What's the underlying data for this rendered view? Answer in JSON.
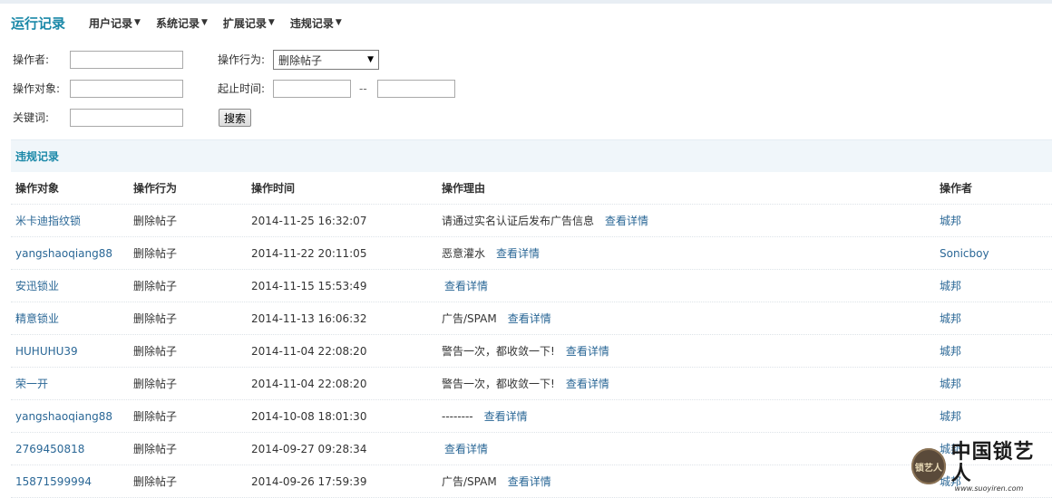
{
  "nav": {
    "title": "运行记录",
    "items": [
      {
        "label": "用户记录"
      },
      {
        "label": "系统记录"
      },
      {
        "label": "扩展记录"
      },
      {
        "label": "违规记录"
      }
    ]
  },
  "search": {
    "operator_label": "操作者:",
    "operator_value": "",
    "target_label": "操作对象:",
    "target_value": "",
    "keyword_label": "关键词:",
    "keyword_value": "",
    "action_label": "操作行为:",
    "action_selected": "删除帖子",
    "time_label": "起止时间:",
    "time_start": "",
    "time_end": "",
    "time_separator": "--",
    "search_button": "搜索"
  },
  "section": {
    "title": "违规记录"
  },
  "table": {
    "columns": [
      "操作对象",
      "操作行为",
      "操作时间",
      "操作理由",
      "操作者"
    ],
    "rows": [
      {
        "target": "米卡迪指纹锁",
        "action": "删除帖子",
        "time": "2014-11-25 16:32:07",
        "reason": "请通过实名认证后发布广告信息",
        "detail": "查看详情",
        "operator": "城邦"
      },
      {
        "target": "yangshaoqiang88",
        "action": "删除帖子",
        "time": "2014-11-22 20:11:05",
        "reason": "恶意灌水",
        "detail": "查看详情",
        "operator": "Sonicboy"
      },
      {
        "target": "安迅锁业",
        "action": "删除帖子",
        "time": "2014-11-15 15:53:49",
        "reason": "",
        "detail": "查看详情",
        "operator": "城邦"
      },
      {
        "target": "精意锁业",
        "action": "删除帖子",
        "time": "2014-11-13 16:06:32",
        "reason": "广告/SPAM",
        "detail": "查看详情",
        "operator": "城邦"
      },
      {
        "target": "HUHUHU39",
        "action": "删除帖子",
        "time": "2014-11-04 22:08:20",
        "reason": "警告一次，都收敛一下!",
        "detail": "查看详情",
        "operator": "城邦"
      },
      {
        "target": "荣一开",
        "action": "删除帖子",
        "time": "2014-11-04 22:08:20",
        "reason": "警告一次，都收敛一下!",
        "detail": "查看详情",
        "operator": "城邦"
      },
      {
        "target": "yangshaoqiang88",
        "action": "删除帖子",
        "time": "2014-10-08 18:01:30",
        "reason": "--------",
        "detail": "查看详情",
        "operator": "城邦"
      },
      {
        "target": "2769450818",
        "action": "删除帖子",
        "time": "2014-09-27 09:28:34",
        "reason": "",
        "detail": "查看详情",
        "operator": "城邦"
      },
      {
        "target": "15871599994",
        "action": "删除帖子",
        "time": "2014-09-26 17:59:39",
        "reason": "广告/SPAM",
        "detail": "查看详情",
        "operator": "城邦"
      }
    ]
  },
  "watermark": {
    "seal": "锁艺人",
    "name": "中国锁艺人",
    "url": "www.suoyiren.com"
  },
  "colors": {
    "accent": "#1a88a8",
    "link": "#2a6796",
    "section_bg": "#f0f6fa"
  }
}
